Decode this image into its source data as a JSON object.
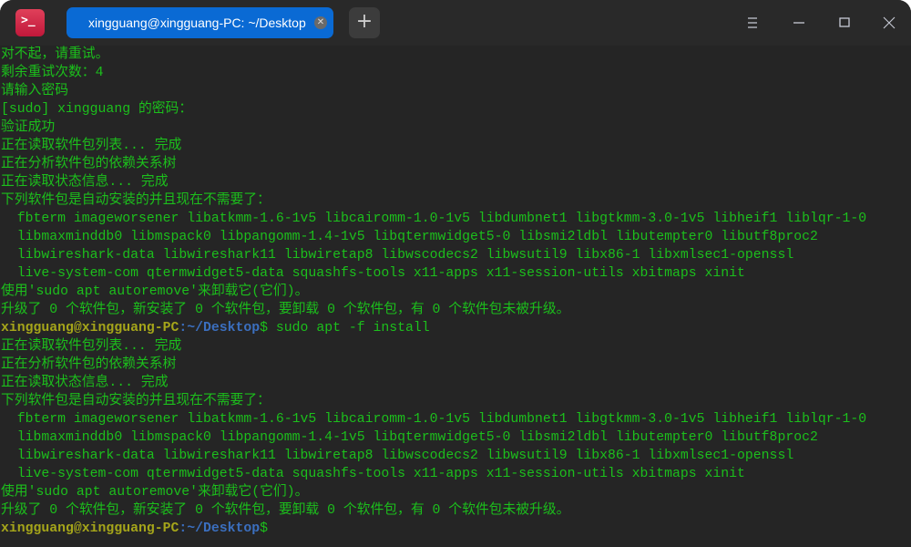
{
  "window": {
    "tab_title": "xingguang@xingguang-PC: ~/Desktop",
    "tab_close_icon": "close-icon",
    "new_tab_label": "+",
    "app_icon_glyph": ">_"
  },
  "colors": {
    "text": "#1cbf1c",
    "prompt_user": "#a5a51a",
    "prompt_path": "#3b6fbf",
    "tab_active": "#0a6ad4",
    "background": "#252525"
  },
  "terminal": {
    "lines": [
      [
        {
          "t": "对不起，请重试。",
          "c": "green"
        }
      ],
      [
        {
          "t": "剩余重试次数：4",
          "c": "green"
        }
      ],
      [
        {
          "t": "请输入密码",
          "c": "green"
        }
      ],
      [
        {
          "t": "[sudo] xingguang 的密码：",
          "c": "green"
        }
      ],
      [
        {
          "t": "验证成功",
          "c": "green"
        }
      ],
      [
        {
          "t": "正在读取软件包列表... 完成",
          "c": "green"
        }
      ],
      [
        {
          "t": "正在分析软件包的依赖关系树",
          "c": "green"
        }
      ],
      [
        {
          "t": "正在读取状态信息... 完成",
          "c": "green"
        }
      ],
      [
        {
          "t": "下列软件包是自动安装的并且现在不需要了：",
          "c": "green"
        }
      ],
      [
        {
          "t": "  fbterm imageworsener libatkmm-1.6-1v5 libcairomm-1.0-1v5 libdumbnet1 libgtkmm-3.0-1v5 libheif1 liblqr-1-0",
          "c": "green"
        }
      ],
      [
        {
          "t": "  libmaxminddb0 libmspack0 libpangomm-1.4-1v5 libqtermwidget5-0 libsmi2ldbl libutempter0 libutf8proc2",
          "c": "green"
        }
      ],
      [
        {
          "t": "  libwireshark-data libwireshark11 libwiretap8 libwscodecs2 libwsutil9 libx86-1 libxmlsec1-openssl",
          "c": "green"
        }
      ],
      [
        {
          "t": "  live-system-com qtermwidget5-data squashfs-tools x11-apps x11-session-utils xbitmaps xinit",
          "c": "green"
        }
      ],
      [
        {
          "t": "使用'sudo apt autoremove'来卸载它(它们)。",
          "c": "green"
        }
      ],
      [
        {
          "t": "升级了 0 个软件包，新安装了 0 个软件包，要卸载 0 个软件包，有 0 个软件包未被升级。",
          "c": "green"
        }
      ],
      [
        {
          "t": "xingguang@xingguang-PC",
          "c": "user"
        },
        {
          "t": ":~/Desktop",
          "c": "path"
        },
        {
          "t": "$ sudo apt -f install",
          "c": "plain"
        }
      ],
      [
        {
          "t": "正在读取软件包列表... 完成",
          "c": "green"
        }
      ],
      [
        {
          "t": "正在分析软件包的依赖关系树",
          "c": "green"
        }
      ],
      [
        {
          "t": "正在读取状态信息... 完成",
          "c": "green"
        }
      ],
      [
        {
          "t": "下列软件包是自动安装的并且现在不需要了：",
          "c": "green"
        }
      ],
      [
        {
          "t": "  fbterm imageworsener libatkmm-1.6-1v5 libcairomm-1.0-1v5 libdumbnet1 libgtkmm-3.0-1v5 libheif1 liblqr-1-0",
          "c": "green"
        }
      ],
      [
        {
          "t": "  libmaxminddb0 libmspack0 libpangomm-1.4-1v5 libqtermwidget5-0 libsmi2ldbl libutempter0 libutf8proc2",
          "c": "green"
        }
      ],
      [
        {
          "t": "  libwireshark-data libwireshark11 libwiretap8 libwscodecs2 libwsutil9 libx86-1 libxmlsec1-openssl",
          "c": "green"
        }
      ],
      [
        {
          "t": "  live-system-com qtermwidget5-data squashfs-tools x11-apps x11-session-utils xbitmaps xinit",
          "c": "green"
        }
      ],
      [
        {
          "t": "使用'sudo apt autoremove'来卸载它(它们)。",
          "c": "green"
        }
      ],
      [
        {
          "t": "升级了 0 个软件包，新安装了 0 个软件包，要卸载 0 个软件包，有 0 个软件包未被升级。",
          "c": "green"
        }
      ],
      [
        {
          "t": "xingguang@xingguang-PC",
          "c": "user"
        },
        {
          "t": ":~/Desktop",
          "c": "path"
        },
        {
          "t": "$",
          "c": "plain"
        }
      ]
    ]
  }
}
